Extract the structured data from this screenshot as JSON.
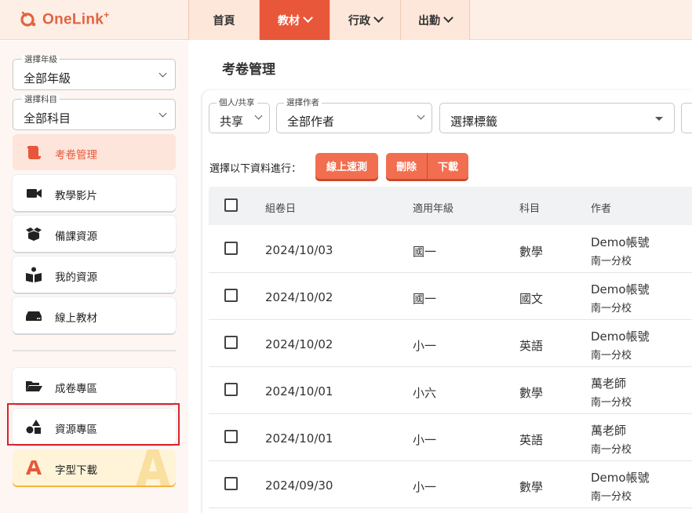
{
  "app": {
    "logo_text": "OneLink",
    "logo_sup": "+"
  },
  "nav": {
    "items": [
      {
        "label": "首頁",
        "dropdown": false,
        "active": false
      },
      {
        "label": "教材",
        "dropdown": true,
        "active": true
      },
      {
        "label": "行政",
        "dropdown": true,
        "active": false
      },
      {
        "label": "出勤",
        "dropdown": true,
        "active": false
      }
    ]
  },
  "sidebar": {
    "grade_select": {
      "legend": "選擇年級",
      "value": "全部年級"
    },
    "subject_select": {
      "legend": "選擇科目",
      "value": "全部科目"
    },
    "menu": [
      {
        "label": "考卷管理",
        "icon": "scroll-icon",
        "active": true
      },
      {
        "label": "教學影片",
        "icon": "video-camera-icon",
        "active": false
      },
      {
        "label": "備課資源",
        "icon": "open-box-icon",
        "active": false
      },
      {
        "label": "我的資源",
        "icon": "reading-person-icon",
        "active": false
      },
      {
        "label": "線上教材",
        "icon": "drive-icon",
        "active": false
      }
    ],
    "extra_menu": [
      {
        "label": "成卷專區",
        "icon": "folder-open-icon"
      },
      {
        "label": "資源專區",
        "icon": "shapes-icon"
      },
      {
        "label": "字型下載",
        "icon": "font-a-icon"
      }
    ]
  },
  "main": {
    "title": "考卷管理",
    "filters": {
      "share": {
        "legend": "個人/共享",
        "value": "共享"
      },
      "author": {
        "legend": "選擇作者",
        "value": "全部作者"
      },
      "tag": {
        "placeholder": "選擇標籤"
      }
    },
    "actions": {
      "label": "選擇以下資料進行：",
      "quick_test": "線上速測",
      "delete": "刪除",
      "download": "下載"
    },
    "table": {
      "headers": {
        "date": "組卷日",
        "grade": "適用年級",
        "subject": "科目",
        "author": "作者"
      },
      "rows": [
        {
          "date": "2024/10/03",
          "grade": "國一",
          "subject": "數學",
          "author": "Demo帳號",
          "school": "南一分校"
        },
        {
          "date": "2024/10/02",
          "grade": "國一",
          "subject": "國文",
          "author": "Demo帳號",
          "school": "南一分校"
        },
        {
          "date": "2024/10/02",
          "grade": "小一",
          "subject": "英語",
          "author": "Demo帳號",
          "school": "南一分校"
        },
        {
          "date": "2024/10/01",
          "grade": "小六",
          "subject": "數學",
          "author": "萬老師",
          "school": "南一分校"
        },
        {
          "date": "2024/10/01",
          "grade": "小一",
          "subject": "英語",
          "author": "萬老師",
          "school": "南一分校"
        },
        {
          "date": "2024/09/30",
          "grade": "小一",
          "subject": "數學",
          "author": "Demo帳號",
          "school": "南一分校"
        }
      ]
    }
  },
  "colors": {
    "accent": "#e9573a",
    "button": "#f26e50",
    "highlight": "#d9232e"
  }
}
